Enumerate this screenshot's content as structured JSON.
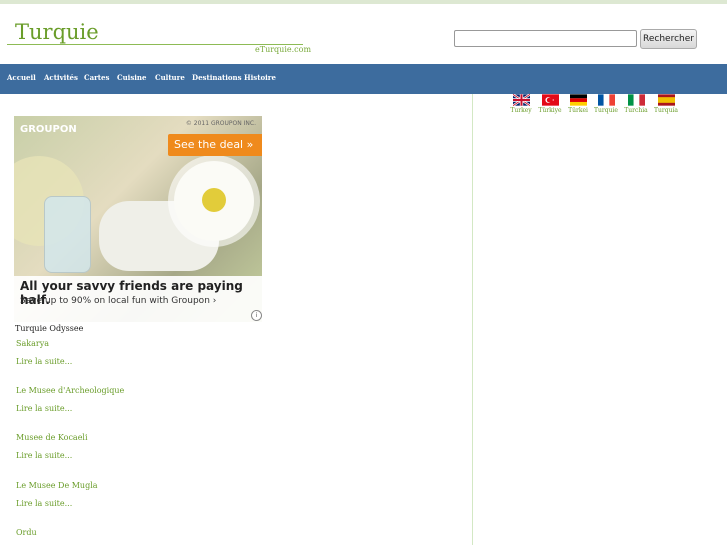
{
  "header": {
    "title": "Turquie",
    "subtitle": "eTurquie.com",
    "search_placeholder": "",
    "search_button": "Rechercher"
  },
  "nav": {
    "items": [
      "Accueil",
      "Activités",
      "Cartes",
      "Cuisine",
      "Culture",
      "Destinations",
      "Histoire"
    ]
  },
  "languages": [
    {
      "label": "Turkey",
      "flag": "uk-flag-icon"
    },
    {
      "label": "Türkiye",
      "flag": "turkey-flag-icon"
    },
    {
      "label": "Türkei",
      "flag": "germany-flag-icon"
    },
    {
      "label": "Turquie",
      "flag": "france-flag-icon"
    },
    {
      "label": "Turchia",
      "flag": "italy-flag-icon"
    },
    {
      "label": "Turquía",
      "flag": "spain-flag-icon"
    }
  ],
  "ad": {
    "brand": "GROUPON",
    "copyright": "© 2011 GROUPON INC.",
    "cta": "See the deal »",
    "headline": "All your savvy friends are paying half.",
    "subline": "Save up to 90% on local fun with Groupon ›",
    "info": "i"
  },
  "content": {
    "caption": "Turquie Odyssee",
    "articles": [
      {
        "title": "Sakarya",
        "more": "Lire la suite..."
      },
      {
        "title": "Le Musee d'Archeologique",
        "more": "Lire la suite..."
      },
      {
        "title": "Musee de Kocaeli",
        "more": "Lire la suite..."
      },
      {
        "title": "Le Musee De Mugla",
        "more": "Lire la suite..."
      },
      {
        "title": "Ordu",
        "more": ""
      }
    ]
  },
  "colors": {
    "accent_green": "#6a9d2a",
    "nav_blue": "#3d6c9e",
    "groupon_orange": "#ef8a1c"
  }
}
